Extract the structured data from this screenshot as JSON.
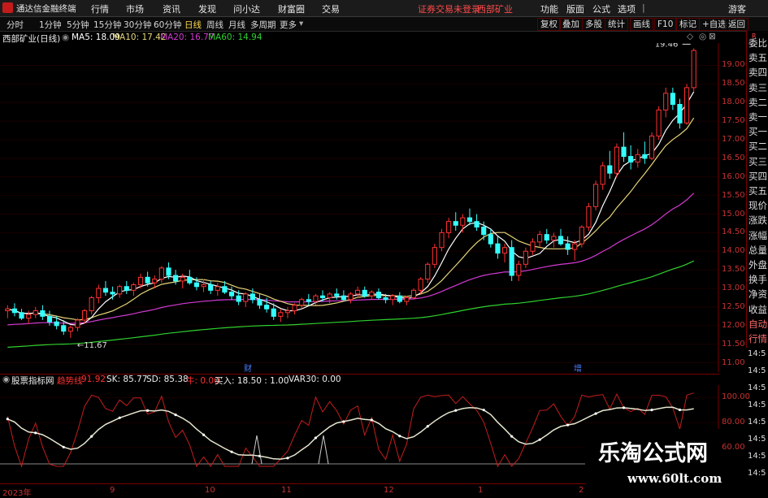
{
  "titlebar": {
    "app_name": "通达信金融终端",
    "menu": [
      "行情",
      "市场",
      "资讯",
      "发现",
      "问小达",
      "财富圈",
      "交易"
    ],
    "notice": "证券交易未登录",
    "stock_tag": "西部矿业",
    "right_menu": [
      "功能",
      "版面",
      "公式",
      "选项"
    ],
    "user": "游客"
  },
  "period_tabs": [
    "分时",
    "1分钟",
    "5分钟",
    "15分钟",
    "30分钟",
    "60分钟",
    "日线",
    "周线",
    "月线",
    "多周期",
    "更多"
  ],
  "active_period": "日线",
  "toolbar_right": [
    "复权",
    "叠加",
    "多股",
    "统计",
    "画线",
    "F10",
    "标记",
    "+自选",
    "返回"
  ],
  "stock_title": "西部矿业(日线)",
  "ma_labels": [
    {
      "label": "MA5: 18.09",
      "color": "#ffffff"
    },
    {
      "label": "MA10: 17.42",
      "color": "#e6d67a"
    },
    {
      "label": "MA20: 16.77",
      "color": "#d43ad4"
    },
    {
      "label": "MA60: 14.94",
      "color": "#2fd12f"
    }
  ],
  "price_ticks": [
    "19.00",
    "18.50",
    "18.00",
    "17.50",
    "17.00",
    "16.50",
    "16.00",
    "15.50",
    "15.00",
    "14.50",
    "14.00",
    "13.50",
    "13.00",
    "12.50",
    "12.00",
    "11.50",
    "11.00"
  ],
  "price_axis": {
    "max": 19.6,
    "min": 10.75
  },
  "high_label": "19.46",
  "low_label": "11.67",
  "event_marks": [
    "财",
    "增"
  ],
  "right_panel": [
    "委比",
    "卖五",
    "卖四",
    "卖三",
    "卖二",
    "卖一",
    "买一",
    "买二",
    "买三",
    "买四",
    "买五",
    "现价",
    "涨跌",
    "涨幅",
    "总量",
    "外盘",
    "换手",
    "净资",
    "收益",
    "自动",
    "行情"
  ],
  "right_panel_top": "R",
  "indicator": {
    "name": "股票指标网",
    "trend_label": "趋势线",
    "trend_value": "91.92",
    "sk": "SK: 85.77",
    "sd": "SD: 85.38",
    "niu": "牛: 0.00",
    "buy": "买入: 18.50 : 1.00",
    "var30": "VAR30: 0.00"
  },
  "indicator_ticks": [
    "100.00",
    "80.00",
    "60.00"
  ],
  "date_labels": [
    "2023年",
    "9",
    "10",
    "11",
    "12",
    "1",
    "2"
  ],
  "time_labels": [
    "14:5",
    "14:5",
    "14:5",
    "14:5",
    "14:5",
    "14:5",
    "14:5",
    "14:5"
  ],
  "watermark": {
    "title": "乐淘公式网",
    "url": "www.60lt.com"
  },
  "colors": {
    "up": "#ff3232",
    "down": "#33ffff",
    "ma5": "#ffffff",
    "ma10": "#e6d67a",
    "ma20": "#d43ad4",
    "ma60": "#2fd12f",
    "axis": "#c83232"
  },
  "chart_data": {
    "type": "candlestick",
    "candles": [
      [
        12.4,
        12.55,
        12.2,
        12.45
      ],
      [
        12.45,
        12.6,
        12.25,
        12.35
      ],
      [
        12.35,
        12.45,
        12.15,
        12.2
      ],
      [
        12.2,
        12.4,
        12.05,
        12.3
      ],
      [
        12.3,
        12.5,
        12.2,
        12.4
      ],
      [
        12.4,
        12.55,
        12.15,
        12.25
      ],
      [
        12.25,
        12.4,
        12.0,
        12.1
      ],
      [
        12.1,
        12.25,
        11.9,
        12.0
      ],
      [
        12.0,
        12.15,
        11.75,
        11.85
      ],
      [
        11.85,
        12.0,
        11.67,
        11.95
      ],
      [
        11.95,
        12.2,
        11.85,
        12.15
      ],
      [
        12.15,
        12.45,
        12.05,
        12.4
      ],
      [
        12.4,
        12.8,
        12.3,
        12.75
      ],
      [
        12.75,
        13.1,
        12.6,
        13.0
      ],
      [
        13.0,
        13.2,
        12.8,
        12.9
      ],
      [
        12.9,
        13.05,
        12.7,
        12.85
      ],
      [
        12.85,
        13.1,
        12.75,
        13.05
      ],
      [
        13.05,
        13.2,
        12.85,
        12.95
      ],
      [
        12.95,
        13.15,
        12.8,
        13.1
      ],
      [
        13.1,
        13.4,
        13.0,
        13.3
      ],
      [
        13.3,
        13.45,
        13.05,
        13.15
      ],
      [
        13.15,
        13.35,
        13.0,
        13.25
      ],
      [
        13.25,
        13.6,
        13.15,
        13.55
      ],
      [
        13.55,
        13.7,
        13.25,
        13.35
      ],
      [
        13.35,
        13.5,
        13.1,
        13.2
      ],
      [
        13.2,
        13.4,
        13.0,
        13.3
      ],
      [
        13.3,
        13.5,
        13.1,
        13.15
      ],
      [
        13.15,
        13.3,
        12.95,
        13.05
      ],
      [
        13.05,
        13.25,
        12.9,
        13.1
      ],
      [
        13.1,
        13.2,
        12.85,
        12.95
      ],
      [
        12.95,
        13.15,
        12.8,
        13.05
      ],
      [
        13.05,
        13.2,
        12.85,
        12.9
      ],
      [
        12.9,
        13.05,
        12.7,
        12.8
      ],
      [
        12.8,
        12.95,
        12.55,
        12.65
      ],
      [
        12.65,
        12.9,
        12.5,
        12.85
      ],
      [
        12.85,
        13.0,
        12.6,
        12.7
      ],
      [
        12.7,
        12.85,
        12.45,
        12.55
      ],
      [
        12.55,
        12.75,
        12.35,
        12.45
      ],
      [
        12.45,
        12.6,
        12.15,
        12.25
      ],
      [
        12.25,
        12.45,
        12.1,
        12.35
      ],
      [
        12.35,
        12.5,
        12.2,
        12.4
      ],
      [
        12.4,
        12.6,
        12.3,
        12.55
      ],
      [
        12.55,
        12.75,
        12.45,
        12.7
      ],
      [
        12.7,
        12.85,
        12.55,
        12.65
      ],
      [
        12.65,
        12.85,
        12.55,
        12.8
      ],
      [
        12.8,
        12.95,
        12.65,
        12.75
      ],
      [
        12.75,
        12.9,
        12.6,
        12.85
      ],
      [
        12.85,
        13.0,
        12.7,
        12.8
      ],
      [
        12.8,
        12.95,
        12.65,
        12.7
      ],
      [
        12.7,
        12.9,
        12.6,
        12.85
      ],
      [
        12.85,
        13.05,
        12.75,
        12.95
      ],
      [
        12.95,
        13.05,
        12.75,
        12.8
      ],
      [
        12.8,
        12.95,
        12.7,
        12.9
      ],
      [
        12.9,
        13.0,
        12.7,
        12.75
      ],
      [
        12.75,
        12.85,
        12.6,
        12.7
      ],
      [
        12.7,
        12.85,
        12.55,
        12.8
      ],
      [
        12.8,
        12.9,
        12.6,
        12.65
      ],
      [
        12.65,
        12.8,
        12.55,
        12.75
      ],
      [
        12.75,
        13.0,
        12.7,
        12.95
      ],
      [
        12.95,
        13.3,
        12.85,
        13.25
      ],
      [
        13.25,
        13.7,
        13.15,
        13.65
      ],
      [
        13.65,
        14.2,
        13.55,
        14.1
      ],
      [
        14.1,
        14.6,
        14.0,
        14.5
      ],
      [
        14.5,
        14.9,
        14.35,
        14.8
      ],
      [
        14.8,
        15.05,
        14.55,
        14.7
      ],
      [
        14.7,
        15.0,
        14.5,
        14.9
      ],
      [
        14.9,
        15.15,
        14.7,
        14.8
      ],
      [
        14.8,
        15.0,
        14.55,
        14.65
      ],
      [
        14.65,
        14.8,
        14.3,
        14.45
      ],
      [
        14.45,
        14.6,
        14.1,
        14.2
      ],
      [
        14.2,
        14.4,
        13.8,
        13.95
      ],
      [
        13.95,
        14.2,
        13.7,
        14.1
      ],
      [
        14.1,
        14.3,
        13.2,
        13.35
      ],
      [
        13.35,
        13.75,
        13.2,
        13.65
      ],
      [
        13.65,
        14.1,
        13.55,
        14.0
      ],
      [
        14.0,
        14.35,
        13.9,
        14.25
      ],
      [
        14.25,
        14.55,
        14.1,
        14.45
      ],
      [
        14.45,
        14.6,
        14.2,
        14.3
      ],
      [
        14.3,
        14.5,
        14.1,
        14.4
      ],
      [
        14.4,
        14.6,
        14.15,
        14.2
      ],
      [
        14.2,
        14.4,
        13.9,
        14.05
      ],
      [
        14.05,
        14.3,
        13.75,
        14.2
      ],
      [
        14.2,
        14.7,
        14.1,
        14.65
      ],
      [
        14.65,
        15.3,
        14.55,
        15.2
      ],
      [
        15.2,
        15.9,
        15.1,
        15.8
      ],
      [
        15.8,
        16.4,
        15.65,
        16.3
      ],
      [
        16.3,
        16.7,
        15.95,
        16.1
      ],
      [
        16.1,
        16.9,
        16.0,
        16.8
      ],
      [
        16.8,
        17.2,
        16.4,
        16.55
      ],
      [
        16.55,
        16.85,
        16.2,
        16.4
      ],
      [
        16.4,
        16.75,
        16.25,
        16.6
      ],
      [
        16.6,
        16.95,
        16.35,
        16.5
      ],
      [
        16.5,
        17.2,
        16.45,
        17.1
      ],
      [
        17.1,
        17.9,
        17.0,
        17.8
      ],
      [
        17.8,
        18.4,
        17.6,
        18.25
      ],
      [
        18.25,
        18.4,
        17.8,
        17.95
      ],
      [
        17.95,
        18.1,
        17.3,
        17.45
      ],
      [
        17.45,
        18.5,
        17.4,
        18.4
      ],
      [
        18.4,
        19.46,
        18.3,
        19.4
      ]
    ]
  }
}
